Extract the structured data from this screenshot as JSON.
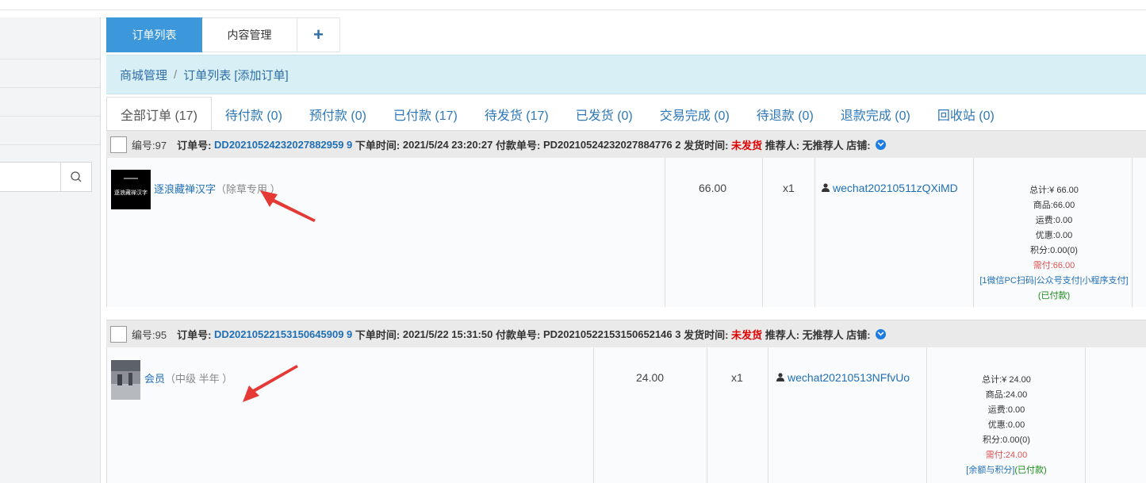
{
  "tabs": [
    {
      "label": "订单列表",
      "active": true
    },
    {
      "label": "内容管理",
      "active": false
    },
    {
      "label": "+",
      "active": false
    }
  ],
  "breadcrumb": {
    "root": "商城管理",
    "separator": "/",
    "current": "订单列表 [添加订单]"
  },
  "status_tabs": [
    {
      "label": "全部订单 (17)",
      "active": true
    },
    {
      "label": "待付款 (0)"
    },
    {
      "label": "预付款 (0)"
    },
    {
      "label": "已付款 (17)"
    },
    {
      "label": "待发货 (17)"
    },
    {
      "label": "已发货 (0)"
    },
    {
      "label": "交易完成 (0)"
    },
    {
      "label": "待退款 (0)"
    },
    {
      "label": "退款完成 (0)"
    },
    {
      "label": "回收站 (0)"
    }
  ],
  "labels": {
    "order_no": "订单号:",
    "order_time": "下单时间:",
    "pay_no": "付款单号:",
    "ship_time": "发货时间:",
    "referrer": "推荐人:",
    "store": "店铺:"
  },
  "orders": [
    {
      "id": "编号:97",
      "order_no": "DD20210524232027882959 9",
      "order_time": "2021/5/24 23:20:27",
      "pay_no": "PD20210524232027884776 2",
      "ship_status": "未发货",
      "referrer": "无推荐人",
      "product_name": "逐浪藏禅汉字",
      "product_spec": "（除草专用 ）",
      "thumb_text": "逐浪藏禅汉字",
      "price": "66.00",
      "qty": "x1",
      "buyer": "wechat20210511zQXiMD",
      "total": "总计:¥ 66.00",
      "goods": "商品:66.00",
      "shipping": "运费:0.00",
      "discount": "优惠:0.00",
      "points": "积分:0.00(0)",
      "need_pay": "需付:66.00",
      "pay_method": "[1微信PC扫码|公众号支付|小程序支付]",
      "pay_status": "(已付款)"
    },
    {
      "id": "编号:95",
      "order_no": "DD20210522153150645909 9",
      "order_time": "2021/5/22 15:31:50",
      "pay_no": "PD20210522153150652146 3",
      "ship_status": "未发货",
      "referrer": "无推荐人",
      "product_name": "会员",
      "product_spec": "（中级 半年 ）",
      "price": "24.00",
      "qty": "x1",
      "buyer": "wechat20210513NFfvUo",
      "total": "总计:¥ 24.00",
      "goods": "商品:24.00",
      "shipping": "运费:0.00",
      "discount": "优惠:0.00",
      "points": "积分:0.00(0)",
      "need_pay": "需付:24.00",
      "pay_method": "[余额与积分]",
      "pay_status": "(已付款)"
    }
  ],
  "colors": {
    "accent": "#3c98db",
    "link": "#1f6fb5",
    "alert": "#e00000",
    "annotation": "#e53935"
  }
}
